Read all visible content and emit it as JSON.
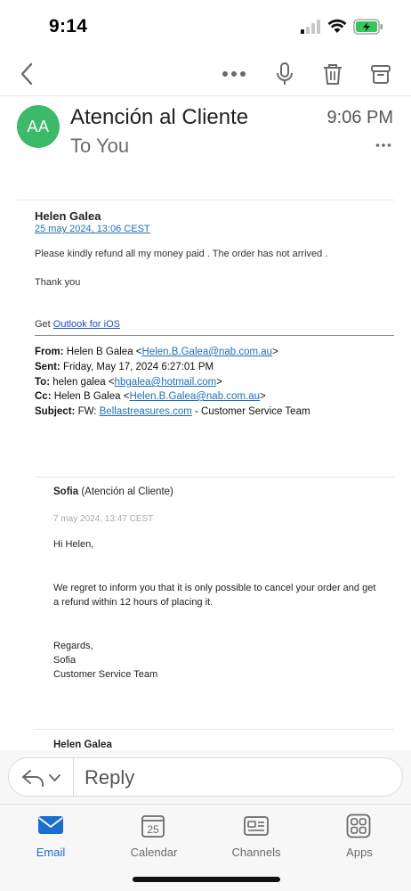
{
  "status_bar": {
    "time": "9:14"
  },
  "toolbar": {
    "back_icon": "chevron-left-icon",
    "more_icon": "more-horizontal-icon",
    "mic_icon": "microphone-icon",
    "trash_icon": "trash-icon",
    "archive_icon": "archive-icon"
  },
  "header": {
    "avatar_initials": "AA",
    "avatar_color": "#3cba6a",
    "sender": "Atención al Cliente",
    "recipient": "To You",
    "time": "9:06 PM"
  },
  "message": {
    "from_name": "Helen Galea",
    "date": "25 may 2024, 13:06 CEST",
    "para1": "Please kindly refund all my money paid . The order has not arrived .",
    "para2": "Thank you",
    "get_prefix": "Get ",
    "get_link": "Outlook for iOS",
    "forwarded": {
      "from_label": "From:",
      "from_name": " Helen B Galea <",
      "from_email": "Helen.B.Galea@nab.com.au",
      "from_end": ">",
      "sent_label": "Sent:",
      "sent_value": " Friday, May 17, 2024 6:27:01 PM",
      "to_label": "To:",
      "to_name": " helen galea <",
      "to_email": "hbgalea@hotmail.com",
      "to_end": ">",
      "cc_label": "Cc:",
      "cc_name": " Helen B Galea <",
      "cc_email": "Helen.B.Galea@nab.com.au",
      "cc_end": ">",
      "subject_label": "Subject:",
      "subject_prefix": " FW: ",
      "subject_link": "Bellastreasures.com",
      "subject_suffix": " - Customer Service Team"
    },
    "quoted": {
      "from_name": "Sofia",
      "from_org": " (Atención al Cliente)",
      "date": "7 may 2024, 13:47 CEST",
      "greeting": "Hi Helen,",
      "line1": "We regret to inform you that it is only possible to cancel your order and get",
      "line2": "a refund within 12 hours of placing it.",
      "regards": "Regards,",
      "signature_name": "Sofia",
      "signature_team": "Customer Service Team"
    },
    "quoted2_from": "Helen Galea"
  },
  "reply": {
    "label": "Reply"
  },
  "tabs": [
    {
      "label": "Email",
      "icon": "mail-icon",
      "active": true
    },
    {
      "label": "Calendar",
      "icon": "calendar-icon",
      "date": "25",
      "active": false
    },
    {
      "label": "Channels",
      "icon": "channels-icon",
      "active": false
    },
    {
      "label": "Apps",
      "icon": "apps-icon",
      "active": false
    }
  ],
  "colors": {
    "accent": "#1a6fd1",
    "link": "#1f6fbf",
    "battery": "#34c759"
  }
}
